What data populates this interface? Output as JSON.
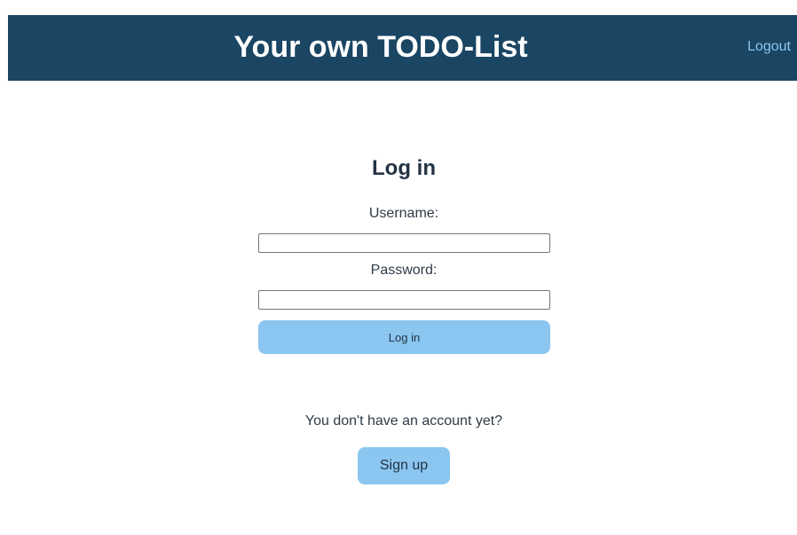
{
  "header": {
    "title": "Your own TODO-List",
    "logout_label": "Logout"
  },
  "login_form": {
    "heading": "Log in",
    "username_label": "Username:",
    "username_value": "",
    "password_label": "Password:",
    "password_value": "",
    "submit_label": "Log in"
  },
  "signup": {
    "prompt": "You don't have an account yet?",
    "button_label": "Sign up"
  },
  "colors": {
    "header_bg": "#1a4563",
    "accent": "#8ac6f0",
    "text": "#243445"
  }
}
